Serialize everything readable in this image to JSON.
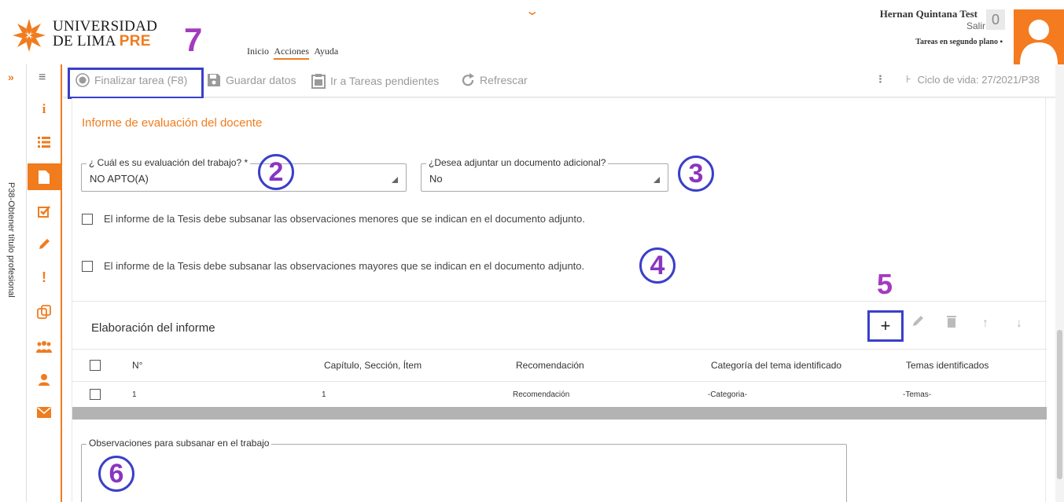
{
  "header": {
    "logo_line1": "UNIVERSIDAD",
    "logo_line2": "DE LIMA",
    "logo_pre": "PRE",
    "annotation_7": "7",
    "nav": [
      "Inicio",
      "Acciones",
      "Ayuda"
    ],
    "user_name": "Hernan Quintana Test",
    "logout": "Salir",
    "notifications_count": "0",
    "background_tasks": "Tareas en segundo plano"
  },
  "rail": {
    "vertical_text": "P38-Obtener título profesional"
  },
  "toolbar": {
    "finalizar": "Finalizar tarea (F8)",
    "guardar": "Guardar datos",
    "tareas": "Ir a Tareas pendientes",
    "refrescar": "Refrescar",
    "ciclo": "Ciclo de vida: 27/2021/P38"
  },
  "form": {
    "section_title": "Informe de evaluación del docente",
    "eval_label": "¿ Cuál es su evaluación del trabajo? *",
    "eval_value": "NO APTO(A)",
    "adjuntar_label": "¿Desea adjuntar un documento adicional?",
    "adjuntar_value": "No",
    "check_menores": "El informe de la Tesis debe subsanar las observaciones menores que se indican en el documento adjunto.",
    "check_mayores": "El informe de la Tesis debe subsanar las observaciones mayores que se indican en el documento adjunto.",
    "annotation_2": "2",
    "annotation_3": "3",
    "annotation_4": "4",
    "annotation_5": "5",
    "annotation_6": "6"
  },
  "panel": {
    "title": "Elaboración del informe",
    "columns": [
      "N°",
      "Capítulo, Sección, Ítem",
      "Recomendación",
      "Categoría del tema identificado",
      "Temas identificados"
    ],
    "rows": [
      [
        "1",
        "1",
        "Recomendación",
        "-Categoria-",
        "-Temas-"
      ]
    ]
  },
  "observaciones": {
    "label": "Observaciones para subsanar en el trabajo"
  },
  "colors": {
    "accent": "#f07c1e",
    "annotation_box": "#3a3fc9",
    "annotation_text": "#a33bbd"
  }
}
